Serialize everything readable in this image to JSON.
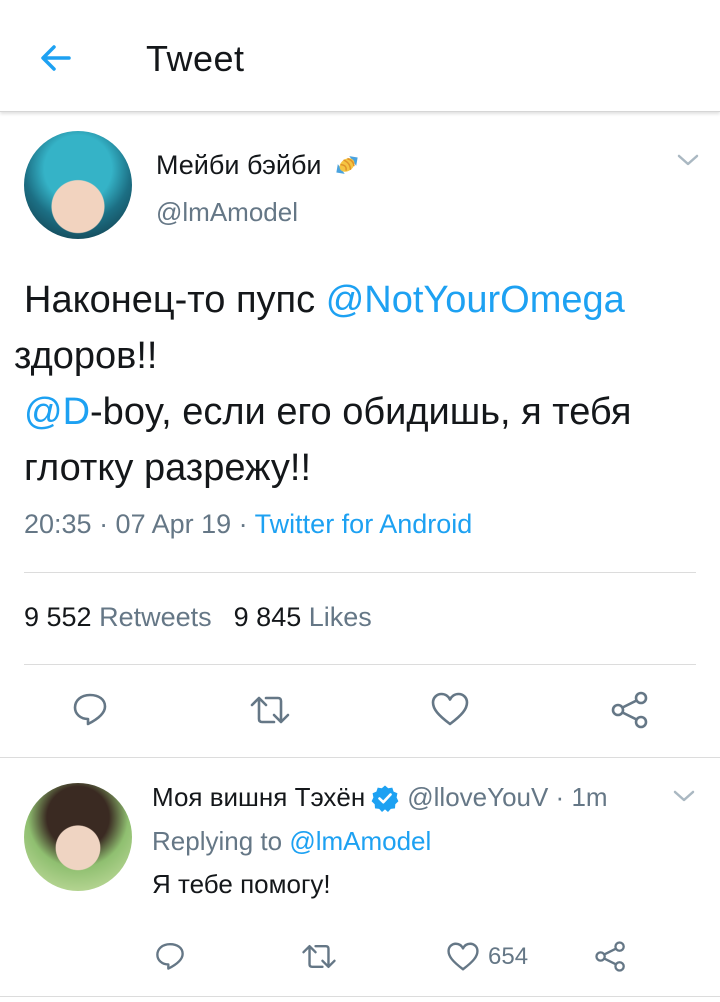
{
  "header": {
    "title": "Tweet"
  },
  "tweet": {
    "author_name": "Мейби бэйби",
    "author_name_emoji": "candy-icon",
    "author_handle": "@lmAmodel",
    "text": {
      "part1": "Наконец-то пупс ",
      "mention1": "@NotYourOmega",
      "part2": " здоров!!",
      "mention2": "@D",
      "part3": "-boy, если его обидишь, я тебя глотку разрежу!!"
    },
    "time": "20:35 · 07 Apr 19 · ",
    "source": "Twitter for Android",
    "retweets_count": "9 552",
    "retweets_label": "Retweets",
    "likes_count": "9 845",
    "likes_label": "Likes"
  },
  "reply": {
    "author_name": "Моя вишня Тэхён",
    "verified": true,
    "author_handle_time": "@lloveYouV · 1m",
    "replying_label": "Replying to ",
    "replying_to": "@lmAmodel",
    "text": "Я тебе помогу!",
    "like_count": "654"
  },
  "colors": {
    "accent": "#1da1f2",
    "secondary_text": "#657786",
    "icon": "#657786"
  }
}
